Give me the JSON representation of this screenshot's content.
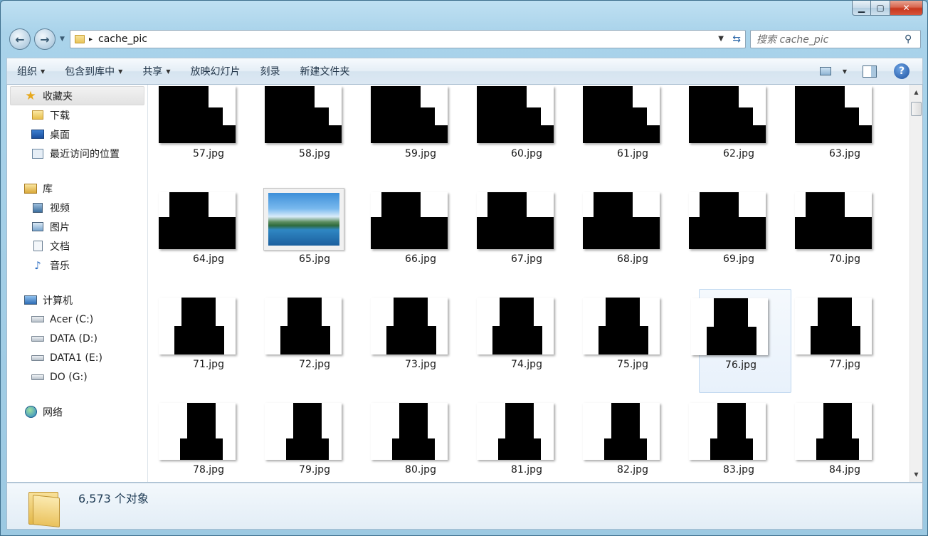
{
  "window": {
    "controls": {
      "minimize": "▁",
      "maximize": "▢",
      "close": "✕"
    }
  },
  "address": {
    "path_segment": "cache_pic",
    "separator": "▸"
  },
  "search": {
    "placeholder": "搜索 cache_pic"
  },
  "toolbar": {
    "items": [
      {
        "label": "组织",
        "has_menu": true
      },
      {
        "label": "包含到库中",
        "has_menu": true
      },
      {
        "label": "共享",
        "has_menu": true
      },
      {
        "label": "放映幻灯片",
        "has_menu": false
      },
      {
        "label": "刻录",
        "has_menu": false
      },
      {
        "label": "新建文件夹",
        "has_menu": false
      }
    ],
    "help": "?"
  },
  "navpane": {
    "favorites": {
      "label": "收藏夹",
      "icon": "star-icon",
      "items": [
        {
          "label": "下载",
          "icon": "downloads-folder-icon"
        },
        {
          "label": "桌面",
          "icon": "desktop-icon"
        },
        {
          "label": "最近访问的位置",
          "icon": "recent-places-icon"
        }
      ]
    },
    "libraries": {
      "label": "库",
      "icon": "library-icon",
      "items": [
        {
          "label": "视频",
          "icon": "video-library-icon"
        },
        {
          "label": "图片",
          "icon": "pictures-library-icon"
        },
        {
          "label": "文档",
          "icon": "documents-library-icon"
        },
        {
          "label": "音乐",
          "icon": "music-library-icon"
        }
      ]
    },
    "computer": {
      "label": "计算机",
      "icon": "computer-icon",
      "items": [
        {
          "label": "Acer (C:)",
          "icon": "system-drive-icon"
        },
        {
          "label": "DATA (D:)",
          "icon": "drive-icon"
        },
        {
          "label": "DATA1 (E:)",
          "icon": "drive-icon"
        },
        {
          "label": "DO (G:)",
          "icon": "removable-drive-icon"
        }
      ]
    },
    "network": {
      "label": "网络",
      "icon": "network-icon"
    }
  },
  "files": [
    "57.jpg",
    "58.jpg",
    "59.jpg",
    "60.jpg",
    "61.jpg",
    "62.jpg",
    "63.jpg",
    "64.jpg",
    "65.jpg",
    "66.jpg",
    "67.jpg",
    "68.jpg",
    "69.jpg",
    "70.jpg",
    "71.jpg",
    "72.jpg",
    "73.jpg",
    "74.jpg",
    "75.jpg",
    "76.jpg",
    "77.jpg",
    "78.jpg",
    "79.jpg",
    "80.jpg",
    "81.jpg",
    "82.jpg",
    "83.jpg",
    "84.jpg"
  ],
  "selected_file": "76.jpg",
  "photo_file": "65.jpg",
  "status": {
    "count_text": "6,573 个对象"
  },
  "colors": {
    "selection": "#e8f1fb",
    "accent": "#2a66a8"
  }
}
